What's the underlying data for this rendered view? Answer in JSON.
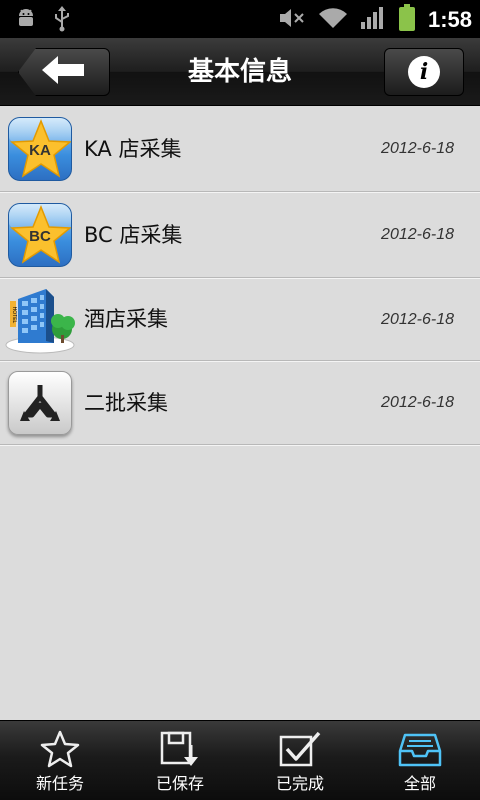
{
  "status_bar": {
    "time": "1:58",
    "icons": [
      "android-debug-icon",
      "usb-icon",
      "mute-icon",
      "wifi-icon",
      "signal-icon",
      "battery-icon"
    ]
  },
  "header": {
    "title": "基本信息",
    "back_icon": "arrow-left-icon",
    "info_icon": "info-icon",
    "info_glyph": "i"
  },
  "list": {
    "items": [
      {
        "label": "KA 店采集",
        "date": "2012-6-18",
        "icon": "star-ka-icon",
        "badge": "KA"
      },
      {
        "label": "BC 店采集",
        "date": "2012-6-18",
        "icon": "star-bc-icon",
        "badge": "BC"
      },
      {
        "label": "酒店采集",
        "date": "2012-6-18",
        "icon": "hotel-icon",
        "badge": "HOTEL"
      },
      {
        "label": "二批采集",
        "date": "2012-6-18",
        "icon": "split-arrows-icon",
        "badge": ""
      }
    ]
  },
  "bottom_nav": {
    "items": [
      {
        "label": "新任务",
        "icon": "star-outline-icon"
      },
      {
        "label": "已保存",
        "icon": "save-icon"
      },
      {
        "label": "已完成",
        "icon": "checkbox-icon"
      },
      {
        "label": "全部",
        "icon": "inbox-icon"
      }
    ],
    "active_color": "#4fc3f7"
  }
}
